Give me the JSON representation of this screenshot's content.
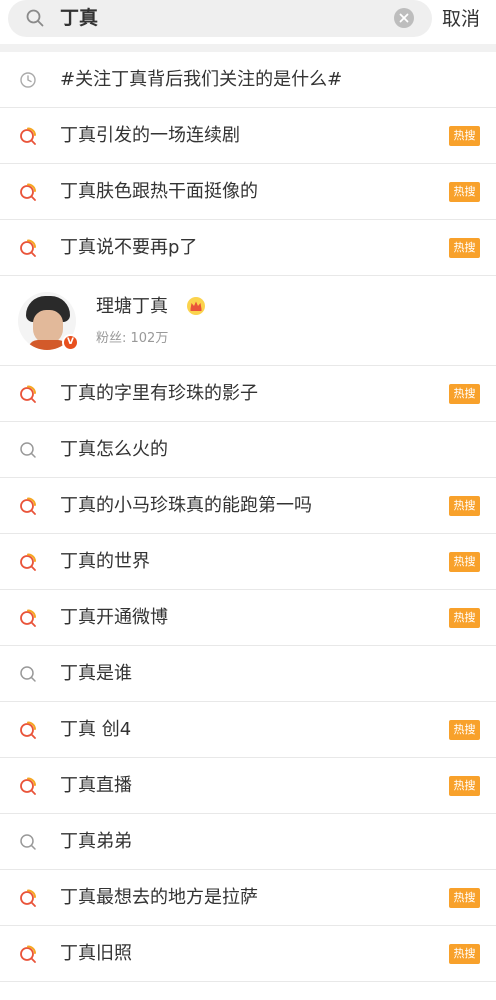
{
  "search": {
    "query": "丁真",
    "cancel_label": "取消"
  },
  "history": {
    "text": "#关注丁真背后我们关注的是什么#"
  },
  "user_card": {
    "name": "理塘丁真",
    "fans": "粉丝: 102万",
    "verified_mark": "V"
  },
  "hot_label": "热搜",
  "colors": {
    "hot_badge": "#f8a12b",
    "hot_icon": "#e9543a",
    "hot_icon_accent": "#f5a623",
    "verified": "#e8501e"
  },
  "suggestions_top": [
    {
      "text": "丁真引发的一场连续剧",
      "hot": true
    },
    {
      "text": "丁真肤色跟热干面挺像的",
      "hot": true
    },
    {
      "text": "丁真说不要再p了",
      "hot": true
    }
  ],
  "suggestions_bottom": [
    {
      "text": "丁真的字里有珍珠的影子",
      "hot": true
    },
    {
      "text": "丁真怎么火的",
      "hot": false
    },
    {
      "text": "丁真的小马珍珠真的能跑第一吗",
      "hot": true
    },
    {
      "text": "丁真的世界",
      "hot": true
    },
    {
      "text": "丁真开通微博",
      "hot": true
    },
    {
      "text": "丁真是谁",
      "hot": false
    },
    {
      "text": "丁真 创4",
      "hot": true
    },
    {
      "text": "丁真直播",
      "hot": true
    },
    {
      "text": "丁真弟弟",
      "hot": false
    },
    {
      "text": "丁真最想去的地方是拉萨",
      "hot": true
    },
    {
      "text": "丁真旧照",
      "hot": true
    }
  ]
}
